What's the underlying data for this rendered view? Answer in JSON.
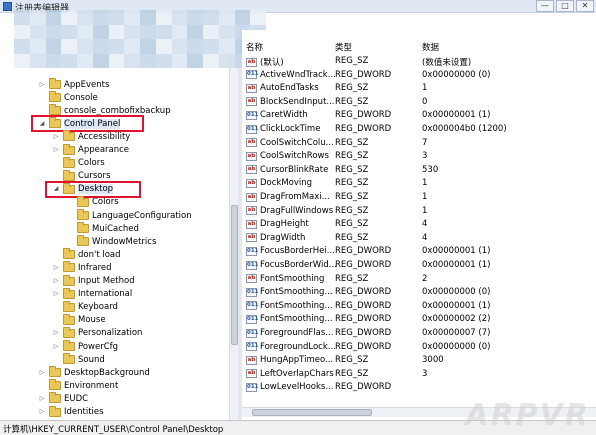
{
  "window": {
    "title": "注册表编辑器",
    "minimize": "—",
    "maximize": "□",
    "close": "✕"
  },
  "tree": {
    "items": [
      {
        "label": "AppEvents",
        "indent": 1,
        "expander": "▷"
      },
      {
        "label": "Console",
        "indent": 1,
        "expander": ""
      },
      {
        "label": "console_combofixbackup",
        "indent": 1,
        "expander": ""
      },
      {
        "label": "Control Panel",
        "indent": 1,
        "expander": "◢",
        "highlight": true
      },
      {
        "label": "Accessibility",
        "indent": 2,
        "expander": "▷"
      },
      {
        "label": "Appearance",
        "indent": 2,
        "expander": "▷"
      },
      {
        "label": "Colors",
        "indent": 2,
        "expander": ""
      },
      {
        "label": "Cursors",
        "indent": 2,
        "expander": ""
      },
      {
        "label": "Desktop",
        "indent": 2,
        "expander": "◢",
        "highlight": true
      },
      {
        "label": "Colors",
        "indent": 3,
        "expander": ""
      },
      {
        "label": "LanguageConfiguration",
        "indent": 3,
        "expander": ""
      },
      {
        "label": "MuiCached",
        "indent": 3,
        "expander": ""
      },
      {
        "label": "WindowMetrics",
        "indent": 3,
        "expander": ""
      },
      {
        "label": "don't load",
        "indent": 2,
        "expander": ""
      },
      {
        "label": "Infrared",
        "indent": 2,
        "expander": "▷"
      },
      {
        "label": "Input Method",
        "indent": 2,
        "expander": "▷"
      },
      {
        "label": "International",
        "indent": 2,
        "expander": "▷"
      },
      {
        "label": "Keyboard",
        "indent": 2,
        "expander": ""
      },
      {
        "label": "Mouse",
        "indent": 2,
        "expander": ""
      },
      {
        "label": "Personalization",
        "indent": 2,
        "expander": "▷"
      },
      {
        "label": "PowerCfg",
        "indent": 2,
        "expander": "▷"
      },
      {
        "label": "Sound",
        "indent": 2,
        "expander": ""
      },
      {
        "label": "DesktopBackground",
        "indent": 1,
        "expander": "▷"
      },
      {
        "label": "Environment",
        "indent": 1,
        "expander": ""
      },
      {
        "label": "EUDC",
        "indent": 1,
        "expander": "▷"
      },
      {
        "label": "Identities",
        "indent": 1,
        "expander": "▷"
      }
    ]
  },
  "list": {
    "headers": {
      "name": "名称",
      "type": "类型",
      "data": "数据"
    },
    "rows": [
      {
        "name": "(默认)",
        "type": "REG_SZ",
        "data": "(数值未设置)",
        "kind": "sz"
      },
      {
        "name": "ActiveWndTrack...",
        "type": "REG_DWORD",
        "data": "0x00000000 (0)",
        "kind": "dword"
      },
      {
        "name": "AutoEndTasks",
        "type": "REG_SZ",
        "data": "1",
        "kind": "sz"
      },
      {
        "name": "BlockSendInput...",
        "type": "REG_SZ",
        "data": "0",
        "kind": "sz"
      },
      {
        "name": "CaretWidth",
        "type": "REG_DWORD",
        "data": "0x00000001 (1)",
        "kind": "dword"
      },
      {
        "name": "ClickLockTime",
        "type": "REG_DWORD",
        "data": "0x000004b0 (1200)",
        "kind": "dword"
      },
      {
        "name": "CoolSwitchColu...",
        "type": "REG_SZ",
        "data": "7",
        "kind": "sz"
      },
      {
        "name": "CoolSwitchRows",
        "type": "REG_SZ",
        "data": "3",
        "kind": "sz"
      },
      {
        "name": "CursorBlinkRate",
        "type": "REG_SZ",
        "data": "530",
        "kind": "sz"
      },
      {
        "name": "DockMoving",
        "type": "REG_SZ",
        "data": "1",
        "kind": "sz"
      },
      {
        "name": "DragFromMaxi...",
        "type": "REG_SZ",
        "data": "1",
        "kind": "sz"
      },
      {
        "name": "DragFullWindows",
        "type": "REG_SZ",
        "data": "1",
        "kind": "sz"
      },
      {
        "name": "DragHeight",
        "type": "REG_SZ",
        "data": "4",
        "kind": "sz"
      },
      {
        "name": "DragWidth",
        "type": "REG_SZ",
        "data": "4",
        "kind": "sz"
      },
      {
        "name": "FocusBorderHei...",
        "type": "REG_DWORD",
        "data": "0x00000001 (1)",
        "kind": "dword"
      },
      {
        "name": "FocusBorderWid...",
        "type": "REG_DWORD",
        "data": "0x00000001 (1)",
        "kind": "dword"
      },
      {
        "name": "FontSmoothing",
        "type": "REG_SZ",
        "data": "2",
        "kind": "sz"
      },
      {
        "name": "FontSmoothing...",
        "type": "REG_DWORD",
        "data": "0x00000000 (0)",
        "kind": "dword"
      },
      {
        "name": "FontSmoothing...",
        "type": "REG_DWORD",
        "data": "0x00000001 (1)",
        "kind": "dword"
      },
      {
        "name": "FontSmoothing...",
        "type": "REG_DWORD",
        "data": "0x00000002 (2)",
        "kind": "dword"
      },
      {
        "name": "ForegroundFlas...",
        "type": "REG_DWORD",
        "data": "0x00000007 (7)",
        "kind": "dword"
      },
      {
        "name": "ForegroundLock...",
        "type": "REG_DWORD",
        "data": "0x00000000 (0)",
        "kind": "dword"
      },
      {
        "name": "HungAppTimeo...",
        "type": "REG_SZ",
        "data": "3000",
        "kind": "sz"
      },
      {
        "name": "LeftOverlapChars",
        "type": "REG_SZ",
        "data": "3",
        "kind": "sz"
      },
      {
        "name": "LowLevelHooks...",
        "type": "REG_DWORD",
        "data": "",
        "kind": "dword"
      }
    ]
  },
  "status": {
    "path": "计算机\\HKEY_CURRENT_USER\\Control Panel\\Desktop"
  },
  "icons": {
    "sz": "ab",
    "dword": "011"
  },
  "watermark": "ARPVR"
}
